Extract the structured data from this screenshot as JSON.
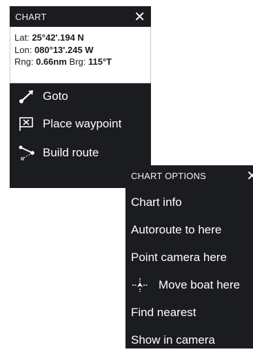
{
  "chart_menu": {
    "title": "CHART",
    "info": {
      "lat_label": "Lat:",
      "lat_value": "25°42'.194 N",
      "lon_label": "Lon:",
      "lon_value": "080°13'.245 W",
      "rng_label": "Rng:",
      "rng_value": "0.66nm",
      "brg_label": "Brg:",
      "brg_value": "115°T"
    },
    "items": [
      {
        "label": "Goto",
        "icon": "goto-icon"
      },
      {
        "label": "Place waypoint",
        "icon": "waypoint-flag-icon"
      },
      {
        "label": "Build route",
        "icon": "route-icon"
      }
    ]
  },
  "chart_options": {
    "title": "CHART OPTIONS",
    "items": [
      {
        "label": "Chart info"
      },
      {
        "label": "Autoroute to here"
      },
      {
        "label": "Point camera here"
      },
      {
        "label": "Move boat here",
        "icon": "move-boat-icon"
      },
      {
        "label": "Find nearest"
      },
      {
        "label": "Show in camera"
      }
    ]
  },
  "colors": {
    "panel_bg": "#1b1c1f",
    "text_light": "#ffffff",
    "info_bg": "#ffffff",
    "info_text": "#1a1a1a"
  }
}
